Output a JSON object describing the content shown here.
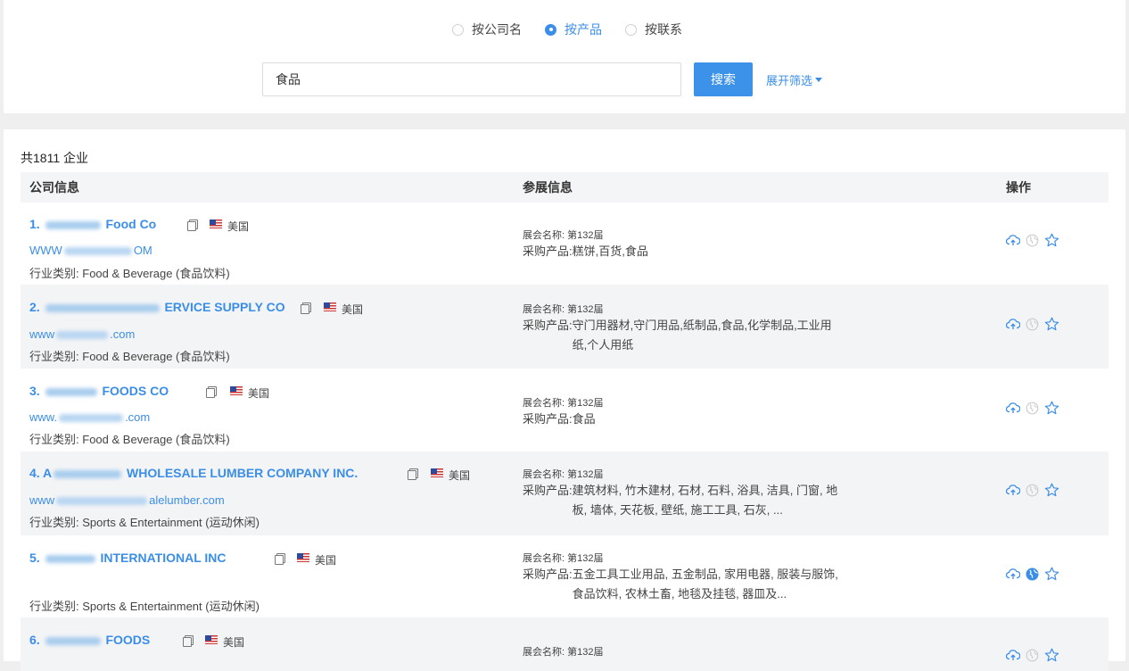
{
  "search": {
    "modes": [
      "按公司名",
      "按产品",
      "按联系"
    ],
    "selected_mode": 1,
    "query": "食品",
    "button": "搜索",
    "expand_filter": "展开筛选"
  },
  "results": {
    "total": "共1811 企业",
    "headers": {
      "company": "公司信息",
      "expo": "参展信息",
      "ops": "操作"
    },
    "expo_label": "展会名称:",
    "purchase_label": "采购产品:",
    "industry_label": "行业类别:",
    "rows": [
      {
        "index": "1.",
        "name_suffix": "Food Co",
        "country": "美国",
        "website_prefix": "WWW",
        "website_suffix": "OM",
        "industry": "Food & Beverage (食品饮料)",
        "expo": "第132届",
        "purchase": "糕饼,百货,食品",
        "globe_active": false
      },
      {
        "index": "2.",
        "name_suffix": "ERVICE SUPPLY CO",
        "country": "美国",
        "website_prefix": "www",
        "website_suffix": ".com",
        "industry": "Food & Beverage (食品饮料)",
        "expo": "第132届",
        "purchase": "守门用器材,守门用品,纸制品,食品,化学制品,工业用纸,个人用纸",
        "globe_active": false
      },
      {
        "index": "3.",
        "name_suffix": "FOODS CO",
        "country": "美国",
        "website_prefix": "www.",
        "website_suffix": ".com",
        "industry": "Food & Beverage (食品饮料)",
        "expo": "第132届",
        "purchase": "食品",
        "globe_active": false
      },
      {
        "index": "4. A",
        "name_suffix": "WHOLESALE LUMBER COMPANY INC.",
        "country": "美国",
        "website_prefix": "www",
        "website_suffix": "alelumber.com",
        "industry": "Sports & Entertainment (运动休闲)",
        "expo": "第132届",
        "purchase": "建筑材料, 竹木建材, 石材, 石料, 浴具, 洁具, 门窗, 地板, 墙体, 天花板, 壁纸, 施工工具, 石灰, ...",
        "globe_active": false
      },
      {
        "index": "5.",
        "name_suffix": "INTERNATIONAL INC",
        "country": "美国",
        "website_prefix": "",
        "website_suffix": "",
        "industry": "Sports & Entertainment (运动休闲)",
        "expo": "第132届",
        "purchase": "五金工具工业用品, 五金制品, 家用电器, 服装与服饰, 食品饮料, 农林土畜, 地毯及挂毯, 器皿及...",
        "globe_active": true
      },
      {
        "index": "6.",
        "name_suffix": "FOODS",
        "country": "美国",
        "website_prefix": "",
        "website_suffix": "",
        "industry": "",
        "expo": "第132届",
        "purchase": "",
        "globe_active": false
      }
    ]
  },
  "colors": {
    "accent": "#3b8ee8",
    "button": "#3c92e8",
    "row_alt": "#f3f4f6",
    "header_bg": "#f4f5f7",
    "page_bg": "#efefef"
  },
  "icons": [
    "cloud-upload-icon",
    "globe-icon",
    "star-icon",
    "copy-icon",
    "us-flag-icon"
  ]
}
